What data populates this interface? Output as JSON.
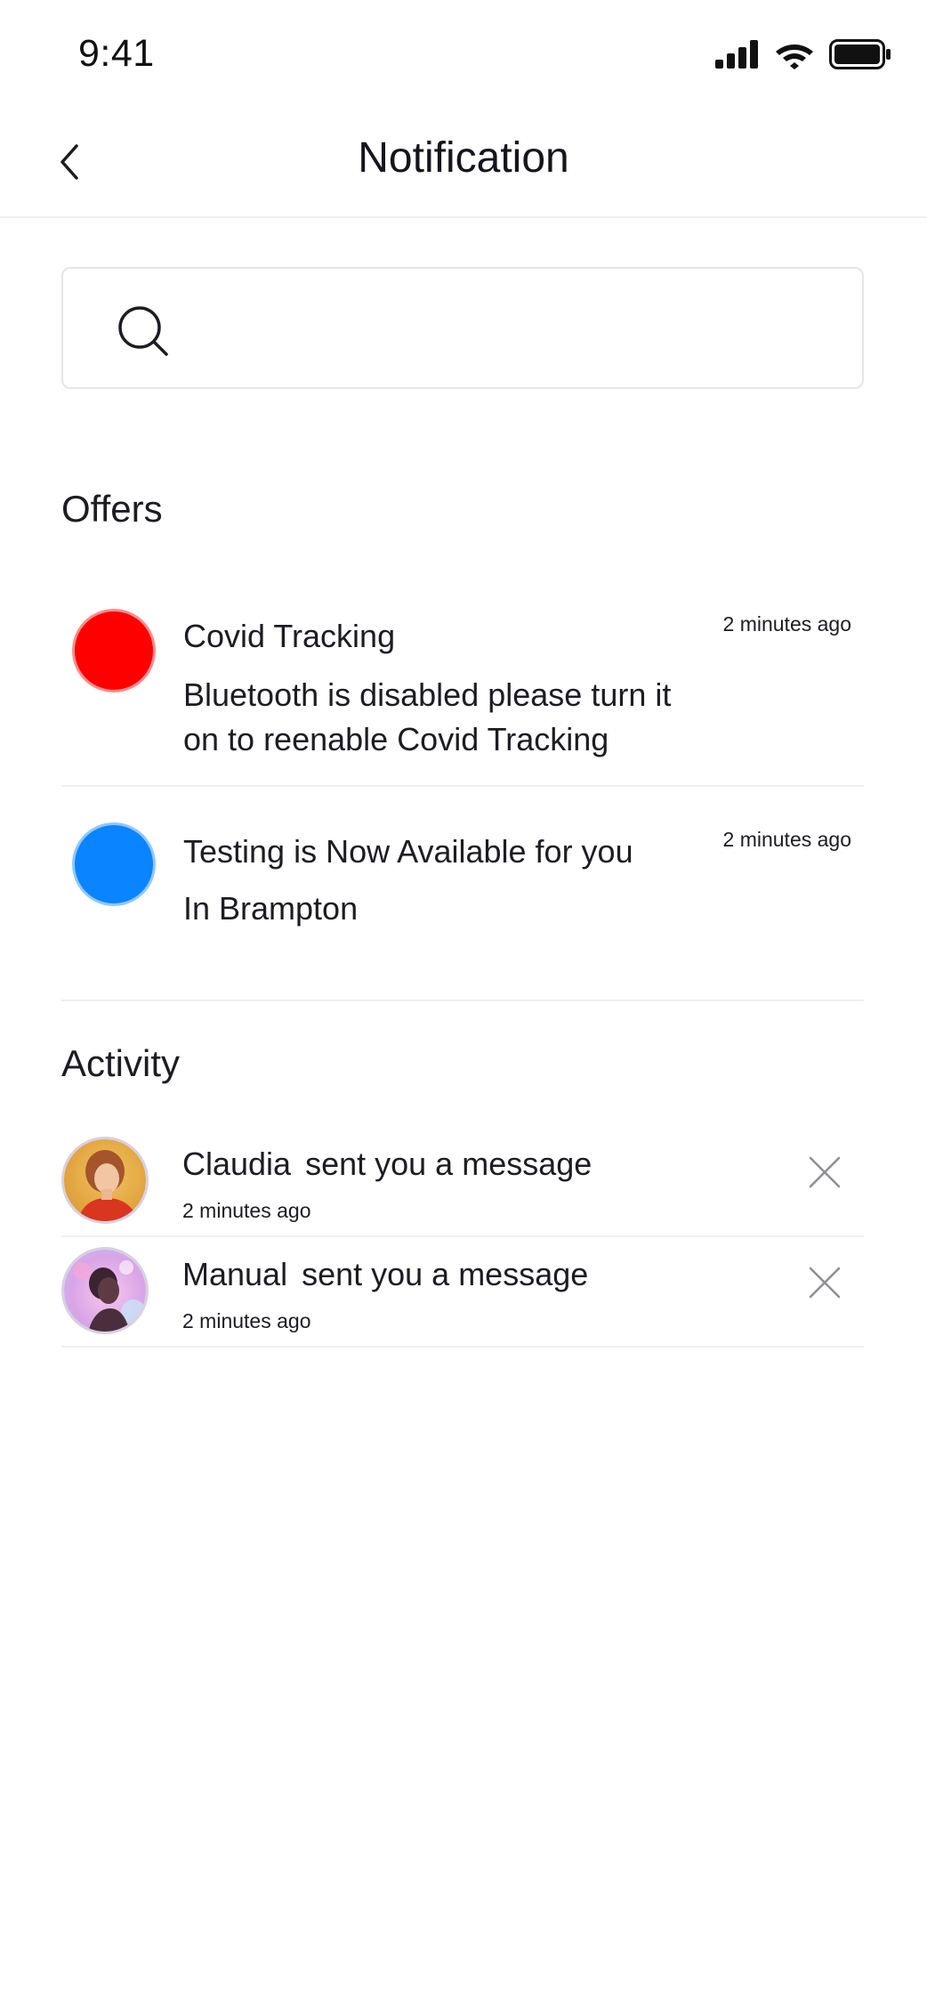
{
  "status_bar": {
    "time": "9:41"
  },
  "nav": {
    "title": "Notification"
  },
  "search": {
    "placeholder": "",
    "value": ""
  },
  "offers": {
    "title": "Offers",
    "items": [
      {
        "title": "Covid Tracking",
        "body": "Bluetooth is disabled please turn it on to reenable Covid Tracking",
        "time": "2 minutes ago",
        "color": "#ff0000"
      },
      {
        "title": "Testing is Now Available for you",
        "body": "In Brampton",
        "time": "2 minutes ago",
        "color": "#0a84ff"
      }
    ]
  },
  "activity": {
    "title": "Activity",
    "items": [
      {
        "name": "Claudia",
        "message": "sent you a message",
        "time": "2 minutes ago"
      },
      {
        "name": "Manual",
        "message": "sent you a message",
        "time": "2 minutes ago"
      }
    ]
  },
  "colors": {
    "text": "#1c1c24",
    "divider": "#efeff1",
    "icon_gray": "#8e8e93"
  }
}
